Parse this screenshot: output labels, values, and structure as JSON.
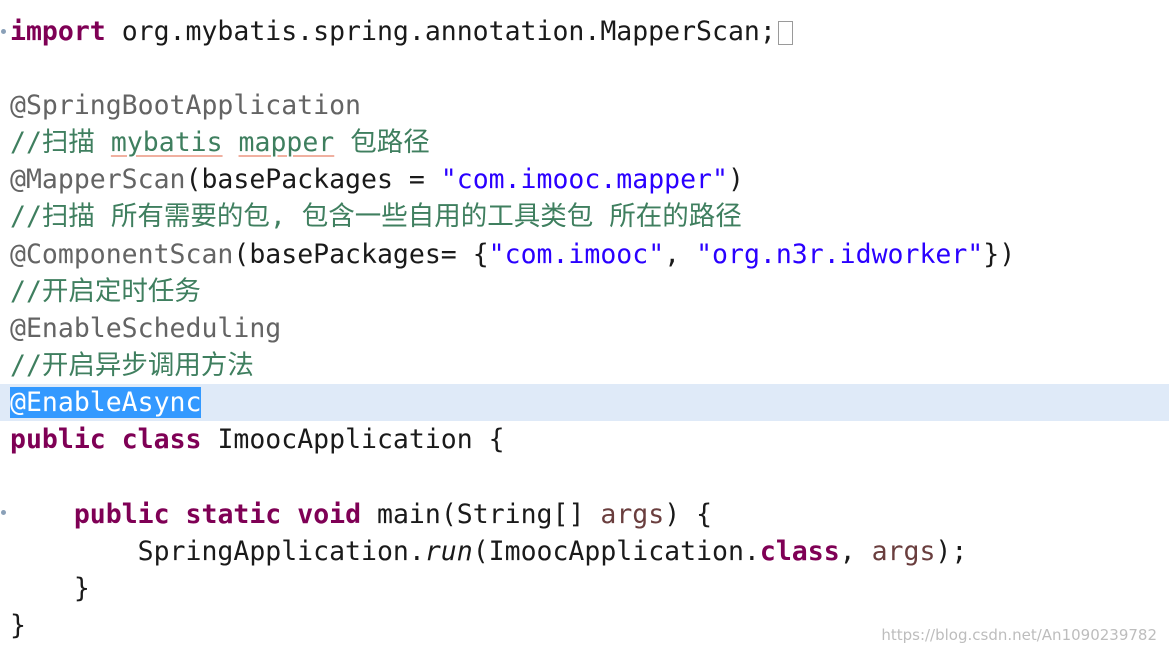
{
  "editor": {
    "lines": {
      "l1": {
        "kw": "import",
        "rest": " org.mybatis.spring.annotation.MapperScan;"
      },
      "l3": {
        "ann": "@SpringBootApplication"
      },
      "l4": {
        "pre": "//扫描 ",
        "w1": "mybatis",
        "mid": " ",
        "w2": "mapper",
        "post": " 包路径"
      },
      "l5": {
        "ann": "@MapperScan",
        "mid": "(basePackages = ",
        "str": "\"com.imooc.mapper\"",
        "end": ")"
      },
      "l6": {
        "cmt": "//扫描 所有需要的包, 包含一些自用的工具类包 所在的路径"
      },
      "l7": {
        "ann": "@ComponentScan",
        "mid": "(basePackages= {",
        "str1": "\"com.imooc\"",
        "sep": ", ",
        "str2": "\"org.n3r.idworker\"",
        "end": "})"
      },
      "l8": {
        "cmt": "//开启定时任务"
      },
      "l9": {
        "ann": "@EnableScheduling"
      },
      "l10": {
        "cmt": "//开启异步调用方法"
      },
      "l11": {
        "ann": "@EnableAsync"
      },
      "l12": {
        "kw1": "public",
        "kw2": "class",
        "rest": " ImoocApplication {"
      },
      "l14": {
        "indent": "    ",
        "kw1": "public",
        "kw2": "static",
        "kw3": "void",
        "mid": " main(String[] ",
        "param": "args",
        "end": ") {"
      },
      "l15": {
        "indent": "        ",
        "pre": "SpringApplication.",
        "method": "run",
        "mid": "(ImoocApplication.",
        "kw": "class",
        "sep": ", ",
        "param": "args",
        "end": ");"
      },
      "l16": {
        "text": "    }"
      },
      "l17": {
        "text": "}"
      }
    }
  },
  "watermark": "https://blog.csdn.net/An1090239782",
  "colors": {
    "keyword": "#7f0055",
    "annotation": "#646464",
    "comment": "#3f7f5f",
    "string": "#2a00ff",
    "parameter": "#6a3e3e",
    "current_line": "#dfeaf8",
    "selection": "#3399ff"
  }
}
